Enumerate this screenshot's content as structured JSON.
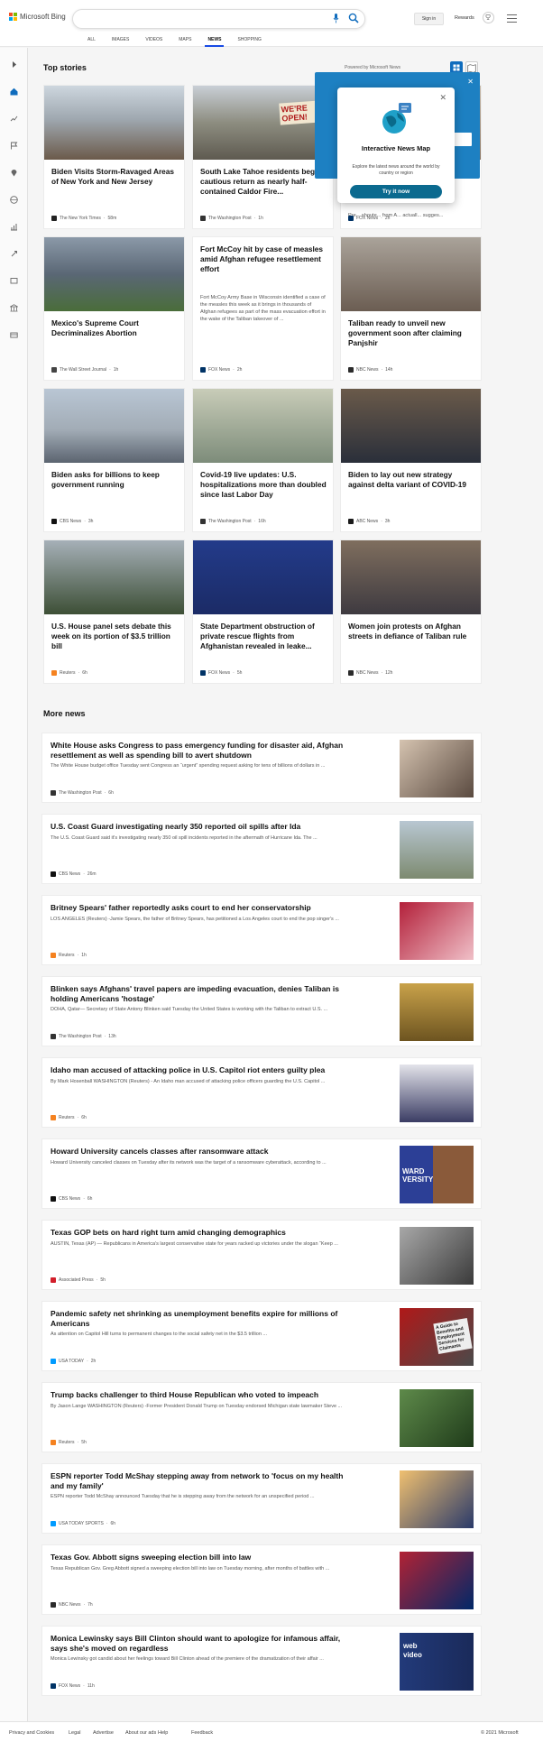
{
  "header": {
    "brand": "Microsoft Bing",
    "signin_label": "Sign in",
    "rewards_label": "Rewards",
    "tabs": [
      {
        "label": "ALL"
      },
      {
        "label": "IMAGES"
      },
      {
        "label": "VIDEOS"
      },
      {
        "label": "MAPS"
      },
      {
        "label": "NEWS",
        "active": true
      },
      {
        "label": "SHOPPING"
      }
    ]
  },
  "colors": {
    "accent": "#174ae4",
    "brand_teal": "#0b6a8f",
    "panel_blue": "#1d80c2"
  },
  "top_stories": {
    "title": "Top stories",
    "powered": "Powered by Microsoft News",
    "cards": [
      {
        "title": "Biden Visits Storm-Ravaged Areas of New York and New Jersey",
        "source": "The New York Times",
        "time": "58m"
      },
      {
        "title": "South Lake Tahoe residents begin cautious return as nearly half-contained Caldor Fire...",
        "source": "The Washington Post",
        "time": "1h"
      },
      {
        "title": "Bi... w... st...",
        "snippet": "Pre... shoute... from A... actuall... sugges...",
        "source": "FOX News",
        "time": "2h"
      },
      {
        "title": "Mexico's Supreme Court Decriminalizes Abortion",
        "source": "The Wall Street Journal",
        "time": "1h"
      },
      {
        "title": "Fort McCoy hit by case of measles amid Afghan refugee resettlement effort",
        "snippet": "Fort McCoy Army Base in Wisconsin identified a case of the measles this week as it brings in thousands of Afghan refugees as part of the mass evacuation effort in the wake of the Taliban takeover of ...",
        "source": "FOX News",
        "time": "2h"
      },
      {
        "title": "Taliban ready to unveil new government soon after claiming Panjshir",
        "source": "NBC News",
        "time": "14h"
      },
      {
        "title": "Biden asks for billions to keep government running",
        "source": "CBS News",
        "time": "3h"
      },
      {
        "title": "Covid-19 live updates: U.S. hospitalizations more than doubled since last Labor Day",
        "source": "The Washington Post",
        "time": "16h"
      },
      {
        "title": "Biden to lay out new strategy against delta variant of COVID-19",
        "source": "ABC News",
        "time": "3h"
      },
      {
        "title": "U.S. House panel sets debate this week on its portion of $3.5 trillion bill",
        "source": "Reuters",
        "time": "6h"
      },
      {
        "title": "State Department obstruction of private rescue flights from Afghanistan revealed in leake...",
        "source": "FOX News",
        "time": "5h"
      },
      {
        "title": "Women join protests on Afghan streets in defiance of Taliban rule",
        "source": "NBC News",
        "time": "12h"
      }
    ]
  },
  "popup": {
    "title": "Interactive News Map",
    "description": "Explore the latest news around the world by country or region",
    "button": "Try it now"
  },
  "more_news": {
    "title": "More news",
    "items": [
      {
        "title": "White House asks Congress to pass emergency funding for disaster aid, Afghan resettlement as well as spending bill to avert shutdown",
        "snippet": "The White House budget office Tuesday sent Congress an “urgent” spending request asking for tens of billions of dollars in ...",
        "source": "The Washington Post",
        "time": "6h"
      },
      {
        "title": "U.S. Coast Guard investigating nearly 350 reported oil spills after Ida",
        "snippet": "The U.S. Coast Guard said it's investigating nearly 350 oil spill incidents reported in the aftermath of Hurricane Ida. The ...",
        "source": "CBS News",
        "time": "26m"
      },
      {
        "title": "Britney Spears' father reportedly asks court to end her conservatorship",
        "snippet": "LOS ANGELES (Reuters) -Jamie Spears, the father of Britney Spears, has petitioned a Los Angeles court to end the pop singer's ...",
        "source": "Reuters",
        "time": "1h"
      },
      {
        "title": "Blinken says Afghans' travel papers are impeding evacuation, denies Taliban is holding Americans 'hostage'",
        "snippet": "DOHA, Qatar— Secretary of State Antony Blinken said Tuesday the United States is working with the Taliban to extract U.S. ...",
        "source": "The Washington Post",
        "time": "13h"
      },
      {
        "title": "Idaho man accused of attacking police in U.S. Capitol riot enters guilty plea",
        "snippet": "By Mark Hosenball WASHINGTON (Reuters) - An Idaho man accused of attacking police officers guarding the U.S. Capitol ...",
        "source": "Reuters",
        "time": "6h"
      },
      {
        "title": "Howard University cancels classes after ransomware attack",
        "snippet": "Howard University canceled classes on Tuesday after its network was the target of a ransomware cyberattack, according to ...",
        "source": "CBS News",
        "time": "6h"
      },
      {
        "title": "Texas GOP bets on hard right turn amid changing demographics",
        "snippet": "AUSTIN, Texas (AP) — Republicans in America's largest conservative state for years racked up victories under the slogan “Keep ...",
        "source": "Associated Press",
        "time": "5h"
      },
      {
        "title": "Pandemic safety net shrinking as unemployment benefits expire for millions of Americans",
        "snippet": "As attention on Capitol Hill turns to permanent changes to the social safety net in the $3.5 trillion ...",
        "source": "USA TODAY",
        "time": "2h"
      },
      {
        "title": "Trump backs challenger to third House Republican who voted to impeach",
        "snippet": "By Jason Lange WASHINGTON (Reuters) -Former President Donald Trump on Tuesday endorsed Michigan state lawmaker Steve ...",
        "source": "Reuters",
        "time": "5h"
      },
      {
        "title": "ESPN reporter Todd McShay stepping away from network to 'focus on my health and my family'",
        "snippet": "ESPN reporter Todd McShay announced Tuesday that he is stepping away from the network for an unspecified period ...",
        "source": "USA TODAY SPORTS",
        "time": "6h"
      },
      {
        "title": "Texas Gov. Abbott signs sweeping election bill into law",
        "snippet": "Texas Republican Gov. Greg Abbott signed a sweeping election bill into law on Tuesday morning, after months of battles with ...",
        "source": "NBC News",
        "time": "7h"
      },
      {
        "title": "Monica Lewinsky says Bill Clinton should want to apologize for infamous affair, says she's moved on regardless",
        "snippet": "Monica Lewinsky got candid about her feelings toward Bill Clinton ahead of the premiere of the dramatization of their affair ...",
        "source": "FOX News",
        "time": "11h"
      }
    ]
  },
  "image_texts": {
    "reopen_sign": "WE'RE OPEN!",
    "howard_banner": "WARD VERSITY",
    "claims_paper": "A Guide to Benefits and Employment Services for Claimants",
    "web_video": "web video"
  },
  "footer": {
    "links": [
      {
        "label": "Privacy and Cookies"
      },
      {
        "label": "Legal"
      },
      {
        "label": "Advertise"
      },
      {
        "label": "About our ads"
      },
      {
        "label": "Help"
      },
      {
        "label": "Feedback"
      }
    ],
    "copyright": "© 2021 Microsoft"
  }
}
